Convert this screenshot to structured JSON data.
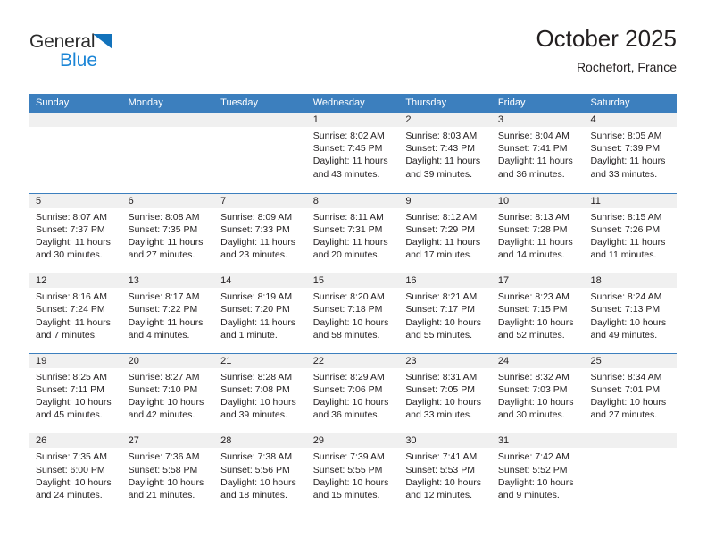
{
  "brand": {
    "name_part1": "General",
    "name_part2": "Blue"
  },
  "header": {
    "title": "October 2025",
    "location": "Rochefort, France"
  },
  "colors": {
    "header_bar": "#3c7fbe",
    "day_number_strip": "#f0f0f0",
    "brand_blue": "#1b85d6",
    "text": "#231f20"
  },
  "weekdays": [
    "Sunday",
    "Monday",
    "Tuesday",
    "Wednesday",
    "Thursday",
    "Friday",
    "Saturday"
  ],
  "weeks": [
    [
      {
        "num": "",
        "sunrise": "",
        "sunset": "",
        "daylight1": "",
        "daylight2": "",
        "empty": true
      },
      {
        "num": "",
        "sunrise": "",
        "sunset": "",
        "daylight1": "",
        "daylight2": "",
        "empty": true
      },
      {
        "num": "",
        "sunrise": "",
        "sunset": "",
        "daylight1": "",
        "daylight2": "",
        "empty": true
      },
      {
        "num": "1",
        "sunrise": "Sunrise: 8:02 AM",
        "sunset": "Sunset: 7:45 PM",
        "daylight1": "Daylight: 11 hours",
        "daylight2": "and 43 minutes."
      },
      {
        "num": "2",
        "sunrise": "Sunrise: 8:03 AM",
        "sunset": "Sunset: 7:43 PM",
        "daylight1": "Daylight: 11 hours",
        "daylight2": "and 39 minutes."
      },
      {
        "num": "3",
        "sunrise": "Sunrise: 8:04 AM",
        "sunset": "Sunset: 7:41 PM",
        "daylight1": "Daylight: 11 hours",
        "daylight2": "and 36 minutes."
      },
      {
        "num": "4",
        "sunrise": "Sunrise: 8:05 AM",
        "sunset": "Sunset: 7:39 PM",
        "daylight1": "Daylight: 11 hours",
        "daylight2": "and 33 minutes."
      }
    ],
    [
      {
        "num": "5",
        "sunrise": "Sunrise: 8:07 AM",
        "sunset": "Sunset: 7:37 PM",
        "daylight1": "Daylight: 11 hours",
        "daylight2": "and 30 minutes."
      },
      {
        "num": "6",
        "sunrise": "Sunrise: 8:08 AM",
        "sunset": "Sunset: 7:35 PM",
        "daylight1": "Daylight: 11 hours",
        "daylight2": "and 27 minutes."
      },
      {
        "num": "7",
        "sunrise": "Sunrise: 8:09 AM",
        "sunset": "Sunset: 7:33 PM",
        "daylight1": "Daylight: 11 hours",
        "daylight2": "and 23 minutes."
      },
      {
        "num": "8",
        "sunrise": "Sunrise: 8:11 AM",
        "sunset": "Sunset: 7:31 PM",
        "daylight1": "Daylight: 11 hours",
        "daylight2": "and 20 minutes."
      },
      {
        "num": "9",
        "sunrise": "Sunrise: 8:12 AM",
        "sunset": "Sunset: 7:29 PM",
        "daylight1": "Daylight: 11 hours",
        "daylight2": "and 17 minutes."
      },
      {
        "num": "10",
        "sunrise": "Sunrise: 8:13 AM",
        "sunset": "Sunset: 7:28 PM",
        "daylight1": "Daylight: 11 hours",
        "daylight2": "and 14 minutes."
      },
      {
        "num": "11",
        "sunrise": "Sunrise: 8:15 AM",
        "sunset": "Sunset: 7:26 PM",
        "daylight1": "Daylight: 11 hours",
        "daylight2": "and 11 minutes."
      }
    ],
    [
      {
        "num": "12",
        "sunrise": "Sunrise: 8:16 AM",
        "sunset": "Sunset: 7:24 PM",
        "daylight1": "Daylight: 11 hours",
        "daylight2": "and 7 minutes."
      },
      {
        "num": "13",
        "sunrise": "Sunrise: 8:17 AM",
        "sunset": "Sunset: 7:22 PM",
        "daylight1": "Daylight: 11 hours",
        "daylight2": "and 4 minutes."
      },
      {
        "num": "14",
        "sunrise": "Sunrise: 8:19 AM",
        "sunset": "Sunset: 7:20 PM",
        "daylight1": "Daylight: 11 hours",
        "daylight2": "and 1 minute."
      },
      {
        "num": "15",
        "sunrise": "Sunrise: 8:20 AM",
        "sunset": "Sunset: 7:18 PM",
        "daylight1": "Daylight: 10 hours",
        "daylight2": "and 58 minutes."
      },
      {
        "num": "16",
        "sunrise": "Sunrise: 8:21 AM",
        "sunset": "Sunset: 7:17 PM",
        "daylight1": "Daylight: 10 hours",
        "daylight2": "and 55 minutes."
      },
      {
        "num": "17",
        "sunrise": "Sunrise: 8:23 AM",
        "sunset": "Sunset: 7:15 PM",
        "daylight1": "Daylight: 10 hours",
        "daylight2": "and 52 minutes."
      },
      {
        "num": "18",
        "sunrise": "Sunrise: 8:24 AM",
        "sunset": "Sunset: 7:13 PM",
        "daylight1": "Daylight: 10 hours",
        "daylight2": "and 49 minutes."
      }
    ],
    [
      {
        "num": "19",
        "sunrise": "Sunrise: 8:25 AM",
        "sunset": "Sunset: 7:11 PM",
        "daylight1": "Daylight: 10 hours",
        "daylight2": "and 45 minutes."
      },
      {
        "num": "20",
        "sunrise": "Sunrise: 8:27 AM",
        "sunset": "Sunset: 7:10 PM",
        "daylight1": "Daylight: 10 hours",
        "daylight2": "and 42 minutes."
      },
      {
        "num": "21",
        "sunrise": "Sunrise: 8:28 AM",
        "sunset": "Sunset: 7:08 PM",
        "daylight1": "Daylight: 10 hours",
        "daylight2": "and 39 minutes."
      },
      {
        "num": "22",
        "sunrise": "Sunrise: 8:29 AM",
        "sunset": "Sunset: 7:06 PM",
        "daylight1": "Daylight: 10 hours",
        "daylight2": "and 36 minutes."
      },
      {
        "num": "23",
        "sunrise": "Sunrise: 8:31 AM",
        "sunset": "Sunset: 7:05 PM",
        "daylight1": "Daylight: 10 hours",
        "daylight2": "and 33 minutes."
      },
      {
        "num": "24",
        "sunrise": "Sunrise: 8:32 AM",
        "sunset": "Sunset: 7:03 PM",
        "daylight1": "Daylight: 10 hours",
        "daylight2": "and 30 minutes."
      },
      {
        "num": "25",
        "sunrise": "Sunrise: 8:34 AM",
        "sunset": "Sunset: 7:01 PM",
        "daylight1": "Daylight: 10 hours",
        "daylight2": "and 27 minutes."
      }
    ],
    [
      {
        "num": "26",
        "sunrise": "Sunrise: 7:35 AM",
        "sunset": "Sunset: 6:00 PM",
        "daylight1": "Daylight: 10 hours",
        "daylight2": "and 24 minutes."
      },
      {
        "num": "27",
        "sunrise": "Sunrise: 7:36 AM",
        "sunset": "Sunset: 5:58 PM",
        "daylight1": "Daylight: 10 hours",
        "daylight2": "and 21 minutes."
      },
      {
        "num": "28",
        "sunrise": "Sunrise: 7:38 AM",
        "sunset": "Sunset: 5:56 PM",
        "daylight1": "Daylight: 10 hours",
        "daylight2": "and 18 minutes."
      },
      {
        "num": "29",
        "sunrise": "Sunrise: 7:39 AM",
        "sunset": "Sunset: 5:55 PM",
        "daylight1": "Daylight: 10 hours",
        "daylight2": "and 15 minutes."
      },
      {
        "num": "30",
        "sunrise": "Sunrise: 7:41 AM",
        "sunset": "Sunset: 5:53 PM",
        "daylight1": "Daylight: 10 hours",
        "daylight2": "and 12 minutes."
      },
      {
        "num": "31",
        "sunrise": "Sunrise: 7:42 AM",
        "sunset": "Sunset: 5:52 PM",
        "daylight1": "Daylight: 10 hours",
        "daylight2": "and 9 minutes."
      },
      {
        "num": "",
        "sunrise": "",
        "sunset": "",
        "daylight1": "",
        "daylight2": "",
        "empty": true
      }
    ]
  ]
}
